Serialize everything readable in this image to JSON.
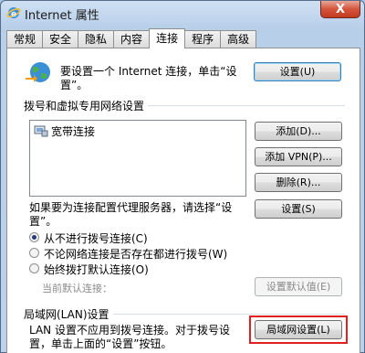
{
  "window": {
    "title": "Internet 属性",
    "close_label": "X"
  },
  "tabs": [
    {
      "label": "常规"
    },
    {
      "label": "安全"
    },
    {
      "label": "隐私"
    },
    {
      "label": "内容"
    },
    {
      "label": "连接",
      "active": true
    },
    {
      "label": "程序"
    },
    {
      "label": "高级"
    }
  ],
  "setup": {
    "text": "要设置一个 Internet 连接，单击“设置”。",
    "text_line1": "要设置一个 Internet 连接，单击“设",
    "text_line2": "置”。",
    "button": "设置(U)"
  },
  "dialup_group": {
    "label": "拨号和虚拟专用网络设置",
    "connections": [
      {
        "name": "宽带连接",
        "icon": "dialup-connection-icon"
      }
    ],
    "buttons": {
      "add": "添加(D)...",
      "add_vpn": "添加 VPN(P)...",
      "remove": "删除(R)...",
      "settings": "设置(S)"
    },
    "proxy_text_line1": "如果要为连接配置代理服务器，请选择“设",
    "proxy_text_line2": "置”。"
  },
  "dial_options": [
    {
      "label": "从不进行拨号连接(C)",
      "checked": true
    },
    {
      "label": "不论网络连接是否存在都进行拨号(W)",
      "checked": false
    },
    {
      "label": "始终拨打默认连接(O)",
      "checked": false
    }
  ],
  "default_row": {
    "label": "当前默认连接：",
    "button": "设置默认值(E)"
  },
  "lan_group": {
    "label": "局域网(LAN)设置",
    "text_line1": "LAN 设置不应用到拨号连接。对于拨号设",
    "text_line2": "置，单击上面的“设置”按钮。",
    "button": "局域网设置(L)"
  },
  "colors": {
    "highlight": "#e02020",
    "close_button": "#c33a1f"
  }
}
